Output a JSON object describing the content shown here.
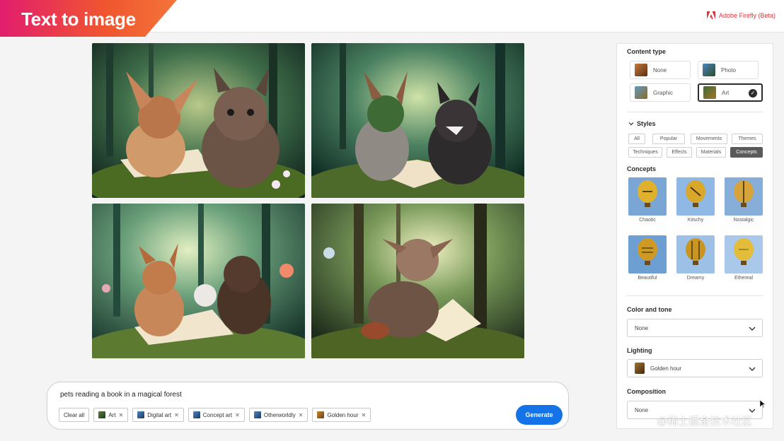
{
  "header": {
    "title": "Text to image",
    "brand": "Adobe Firefly (Beta)"
  },
  "prompt": {
    "text": "pets reading a book in a magical forest",
    "chips": [
      {
        "label": "Clear all",
        "icon": "",
        "removable": false
      },
      {
        "label": "Art",
        "icon": "art-icon",
        "removable": true
      },
      {
        "label": "Digital art",
        "icon": "digital-art-icon",
        "removable": true
      },
      {
        "label": "Concept art",
        "icon": "concept-art-icon",
        "removable": true
      },
      {
        "label": "Otherworldly",
        "icon": "otherworldly-icon",
        "removable": true
      },
      {
        "label": "Golden hour",
        "icon": "golden-hour-icon",
        "removable": true
      }
    ],
    "generate_label": "Generate"
  },
  "panel": {
    "content_type_label": "Content type",
    "content_types": [
      {
        "label": "None",
        "selected": false
      },
      {
        "label": "Photo",
        "selected": false
      },
      {
        "label": "Graphic",
        "selected": false
      },
      {
        "label": "Art",
        "selected": true
      }
    ],
    "styles_label": "Styles",
    "style_tabs": [
      {
        "label": "All",
        "active": false
      },
      {
        "label": "Popular",
        "active": false
      },
      {
        "label": "Movements",
        "active": false
      },
      {
        "label": "Themes",
        "active": false
      },
      {
        "label": "Techniques",
        "active": false
      },
      {
        "label": "Effects",
        "active": false
      },
      {
        "label": "Materials",
        "active": false
      },
      {
        "label": "Concepts",
        "active": true
      }
    ],
    "concepts_label": "Concepts",
    "concepts": [
      {
        "label": "Chaotic"
      },
      {
        "label": "Kitschy"
      },
      {
        "label": "Nostalgic"
      },
      {
        "label": "Beautiful"
      },
      {
        "label": "Dreamy"
      },
      {
        "label": "Ethereal"
      }
    ],
    "color_tone_label": "Color and tone",
    "color_tone_value": "None",
    "lighting_label": "Lighting",
    "lighting_value": "Golden hour",
    "composition_label": "Composition",
    "composition_value": "None"
  },
  "watermark": "@稀土掘金技术社区",
  "colors": {
    "accent": "#1473e6",
    "title_gradient_start": "#e21d6e",
    "title_gradient_end": "#f3743a",
    "brand_red": "#d7373f"
  }
}
